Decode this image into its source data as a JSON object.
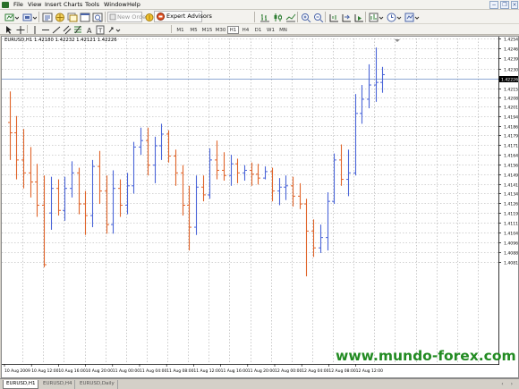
{
  "menu": [
    "File",
    "View",
    "Insert",
    "Charts",
    "Tools",
    "Window",
    "Help"
  ],
  "toolbar": {
    "new_order": "New Order",
    "expert_advisors": "Expert Advisors"
  },
  "timeframes": [
    "M1",
    "M5",
    "M15",
    "M30",
    "H1",
    "H4",
    "D1",
    "W1",
    "MN"
  ],
  "active_timeframe": "H1",
  "chart": {
    "title": "EURUSD,H1  1.42180 1.42232 1.42121 1.42226",
    "watermark": "www.mundo-forex.com",
    "bull_color": "#4a64d8",
    "bear_color": "#e0642a",
    "grid_color": "#a8a8a8",
    "bid_line_color": "#6a8cc4",
    "current_price_label": "1.42226"
  },
  "chart_data": {
    "type": "ohlc",
    "symbol": "EURUSD",
    "timeframe": "H1",
    "ylim": [
      1.40022,
      1.4254
    ],
    "y_ticks": [
      "1.42540",
      "1.42465",
      "1.42390",
      "1.42305",
      "1.42226",
      "1.42155",
      "1.42085",
      "1.42015",
      "1.41940",
      "1.41865",
      "1.41790",
      "1.41715",
      "1.41640",
      "1.41565",
      "1.41490",
      "1.41415",
      "1.41340",
      "1.41265",
      "1.41190",
      "1.41115",
      "1.41040",
      "1.40965",
      "1.40885",
      "1.40810"
    ],
    "x_labels": [
      "10 Aug 2009",
      "10 Aug 12:00",
      "10 Aug 16:00",
      "10 Aug 20:00",
      "11 Aug 00:00",
      "11 Aug 04:00",
      "11 Aug 08:00",
      "11 Aug 12:00",
      "11 Aug 16:00",
      "11 Aug 20:00",
      "12 Aug 00:00",
      "12 Aug 04:00",
      "12 Aug 08:00",
      "12 Aug 12:00"
    ],
    "bars": [
      {
        "o": 1.4189,
        "h": 1.4213,
        "l": 1.416,
        "c": 1.4181
      },
      {
        "o": 1.4181,
        "h": 1.4194,
        "l": 1.4145,
        "c": 1.416
      },
      {
        "o": 1.416,
        "h": 1.4184,
        "l": 1.4138,
        "c": 1.415
      },
      {
        "o": 1.415,
        "h": 1.417,
        "l": 1.4131,
        "c": 1.4143
      },
      {
        "o": 1.4143,
        "h": 1.4157,
        "l": 1.4116,
        "c": 1.4125
      },
      {
        "o": 1.4125,
        "h": 1.4148,
        "l": 1.4077,
        "c": 1.4079
      },
      {
        "o": 1.4119,
        "h": 1.4147,
        "l": 1.4106,
        "c": 1.4138
      },
      {
        "o": 1.4138,
        "h": 1.4145,
        "l": 1.4117,
        "c": 1.4121
      },
      {
        "o": 1.4121,
        "h": 1.4147,
        "l": 1.4113,
        "c": 1.4138
      },
      {
        "o": 1.4138,
        "h": 1.4159,
        "l": 1.4131,
        "c": 1.415
      },
      {
        "o": 1.415,
        "h": 1.4154,
        "l": 1.4118,
        "c": 1.4126
      },
      {
        "o": 1.4126,
        "h": 1.4136,
        "l": 1.4102,
        "c": 1.4117
      },
      {
        "o": 1.4117,
        "h": 1.416,
        "l": 1.4108,
        "c": 1.4155
      },
      {
        "o": 1.4155,
        "h": 1.4167,
        "l": 1.4126,
        "c": 1.4136
      },
      {
        "o": 1.4136,
        "h": 1.4148,
        "l": 1.4103,
        "c": 1.411
      },
      {
        "o": 1.411,
        "h": 1.4152,
        "l": 1.4103,
        "c": 1.4138
      },
      {
        "o": 1.4138,
        "h": 1.4145,
        "l": 1.4116,
        "c": 1.4125
      },
      {
        "o": 1.4125,
        "h": 1.415,
        "l": 1.4118,
        "c": 1.414
      },
      {
        "o": 1.414,
        "h": 1.4174,
        "l": 1.4134,
        "c": 1.417
      },
      {
        "o": 1.417,
        "h": 1.4185,
        "l": 1.4164,
        "c": 1.4175
      },
      {
        "o": 1.4175,
        "h": 1.4185,
        "l": 1.4148,
        "c": 1.4156
      },
      {
        "o": 1.4156,
        "h": 1.4178,
        "l": 1.4142,
        "c": 1.4171
      },
      {
        "o": 1.4171,
        "h": 1.4188,
        "l": 1.416,
        "c": 1.418
      },
      {
        "o": 1.418,
        "h": 1.4183,
        "l": 1.4158,
        "c": 1.4163
      },
      {
        "o": 1.4163,
        "h": 1.4168,
        "l": 1.414,
        "c": 1.415
      },
      {
        "o": 1.415,
        "h": 1.4156,
        "l": 1.4117,
        "c": 1.4125
      },
      {
        "o": 1.4125,
        "h": 1.414,
        "l": 1.409,
        "c": 1.4108
      },
      {
        "o": 1.4108,
        "h": 1.4148,
        "l": 1.4102,
        "c": 1.4139
      },
      {
        "o": 1.4139,
        "h": 1.4148,
        "l": 1.4128,
        "c": 1.4133
      },
      {
        "o": 1.4133,
        "h": 1.4169,
        "l": 1.413,
        "c": 1.416
      },
      {
        "o": 1.416,
        "h": 1.4175,
        "l": 1.4145,
        "c": 1.4152
      },
      {
        "o": 1.4152,
        "h": 1.4166,
        "l": 1.4144,
        "c": 1.4148
      },
      {
        "o": 1.4148,
        "h": 1.4164,
        "l": 1.414,
        "c": 1.4157
      },
      {
        "o": 1.4157,
        "h": 1.4161,
        "l": 1.4142,
        "c": 1.415
      },
      {
        "o": 1.415,
        "h": 1.4156,
        "l": 1.4144,
        "c": 1.4152
      },
      {
        "o": 1.4152,
        "h": 1.4158,
        "l": 1.414,
        "c": 1.4149
      },
      {
        "o": 1.4149,
        "h": 1.4157,
        "l": 1.4141,
        "c": 1.4146
      },
      {
        "o": 1.4146,
        "h": 1.4155,
        "l": 1.4145,
        "c": 1.4151
      },
      {
        "o": 1.4151,
        "h": 1.4154,
        "l": 1.4128,
        "c": 1.4136
      },
      {
        "o": 1.4136,
        "h": 1.4146,
        "l": 1.4125,
        "c": 1.4139
      },
      {
        "o": 1.4139,
        "h": 1.4148,
        "l": 1.4129,
        "c": 1.414
      },
      {
        "o": 1.414,
        "h": 1.4147,
        "l": 1.4124,
        "c": 1.4132
      },
      {
        "o": 1.4132,
        "h": 1.4142,
        "l": 1.4122,
        "c": 1.4126
      },
      {
        "o": 1.4126,
        "h": 1.413,
        "l": 1.407,
        "c": 1.4105
      },
      {
        "o": 1.4105,
        "h": 1.4114,
        "l": 1.4085,
        "c": 1.4092
      },
      {
        "o": 1.4092,
        "h": 1.411,
        "l": 1.4088,
        "c": 1.41
      },
      {
        "o": 1.41,
        "h": 1.4135,
        "l": 1.409,
        "c": 1.4128
      },
      {
        "o": 1.4128,
        "h": 1.4165,
        "l": 1.4126,
        "c": 1.416
      },
      {
        "o": 1.416,
        "h": 1.4172,
        "l": 1.414,
        "c": 1.4145
      },
      {
        "o": 1.4145,
        "h": 1.4168,
        "l": 1.4132,
        "c": 1.415
      },
      {
        "o": 1.415,
        "h": 1.4211,
        "l": 1.4148,
        "c": 1.4196
      },
      {
        "o": 1.4196,
        "h": 1.4218,
        "l": 1.4188,
        "c": 1.4207
      },
      {
        "o": 1.4207,
        "h": 1.4234,
        "l": 1.42,
        "c": 1.4218
      },
      {
        "o": 1.4218,
        "h": 1.4247,
        "l": 1.4205,
        "c": 1.422
      },
      {
        "o": 1.422,
        "h": 1.4232,
        "l": 1.4212,
        "c": 1.4226
      }
    ]
  },
  "tabs": [
    "EURUSD,H1",
    "EURUSD,H4",
    "EURUSD,Daily"
  ],
  "active_tab": "EURUSD,H1"
}
